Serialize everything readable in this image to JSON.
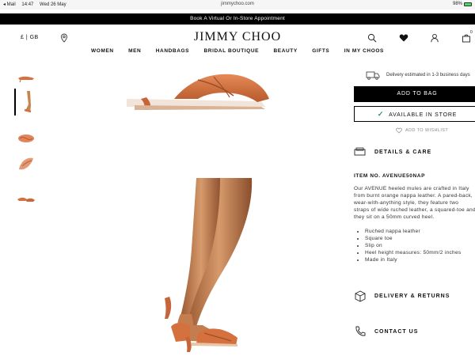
{
  "status_bar": {
    "back_app": "◂ Mail",
    "time": "14:47",
    "date": "Wed 26 May",
    "url": "jimmychoo.com",
    "battery": "98%"
  },
  "promo": {
    "text": "Book A Virtual Or In-Store Appointment"
  },
  "header": {
    "locale": "£ | GB",
    "logo": "JIMMY CHOO",
    "nav": [
      "WOMEN",
      "MEN",
      "HANDBAGS",
      "BRIDAL BOUTIQUE",
      "BEAUTY",
      "GIFTS",
      "IN MY CHOOS"
    ],
    "bag_count": "0"
  },
  "product": {
    "delivery": "Delivery estimated in 1-3 business days",
    "add_to_bag": "ADD TO BAG",
    "available_in_store": "AVAILABLE IN STORE",
    "add_to_wishlist": "ADD TO WISHLIST",
    "details_care": "DETAILS & CARE",
    "item_no": "ITEM NO. AVENUE50NAP",
    "description_lines": [
      "Our AVENUE heeled mules are crafted in Italy",
      "from burnt orange nappa leather. A pared-back,",
      "wear-with-anything style, they feature two",
      "straps of wide ruched leather, a squared-toe and",
      "they sit on a 50mm curved heel."
    ],
    "features": [
      "Ruched nappa leather",
      "Square toe",
      "Slip on",
      "Heel height measures: 50mm/2 inches",
      "Made in Italy"
    ],
    "delivery_returns": "DELIVERY & RETURNS",
    "contact_us": "CONTACT US"
  },
  "colors": {
    "accent": "#000000",
    "leather": "#d4713f",
    "check": "#2a9a5a"
  }
}
